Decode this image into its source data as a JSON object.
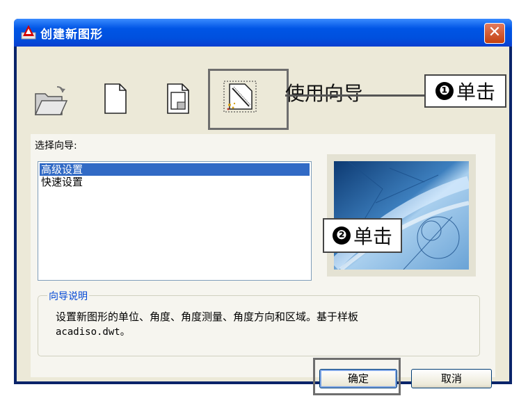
{
  "window": {
    "title": "创建新图形",
    "close_glyph": "✕"
  },
  "toolbar": {
    "items": [
      {
        "name": "open-drawing",
        "icon": "folder-open-icon"
      },
      {
        "name": "start-from-scratch",
        "icon": "blank-page-icon"
      },
      {
        "name": "use-template",
        "icon": "template-page-icon"
      },
      {
        "name": "use-wizard",
        "icon": "wizard-icon"
      }
    ],
    "wizard_heading": "使用向导"
  },
  "wizard": {
    "select_label": "选择向导:",
    "options": [
      "高级设置",
      "快速设置"
    ],
    "selected_index": 0
  },
  "description": {
    "group_title": "向导说明",
    "line1": "设置新图形的单位、角度、角度测量、角度方向和区域。基于样板",
    "line2": "acadiso.dwt。"
  },
  "buttons": {
    "ok": "确定",
    "cancel": "取消"
  },
  "annotations": {
    "callout1": {
      "number": "❶",
      "text": "单击"
    },
    "callout2": {
      "number": "❷",
      "text": "单击"
    }
  },
  "colors": {
    "titlebar": "#0055e5",
    "selection": "#316ac5",
    "dialog_bg": "#ece9d8",
    "close": "#c2410f"
  }
}
